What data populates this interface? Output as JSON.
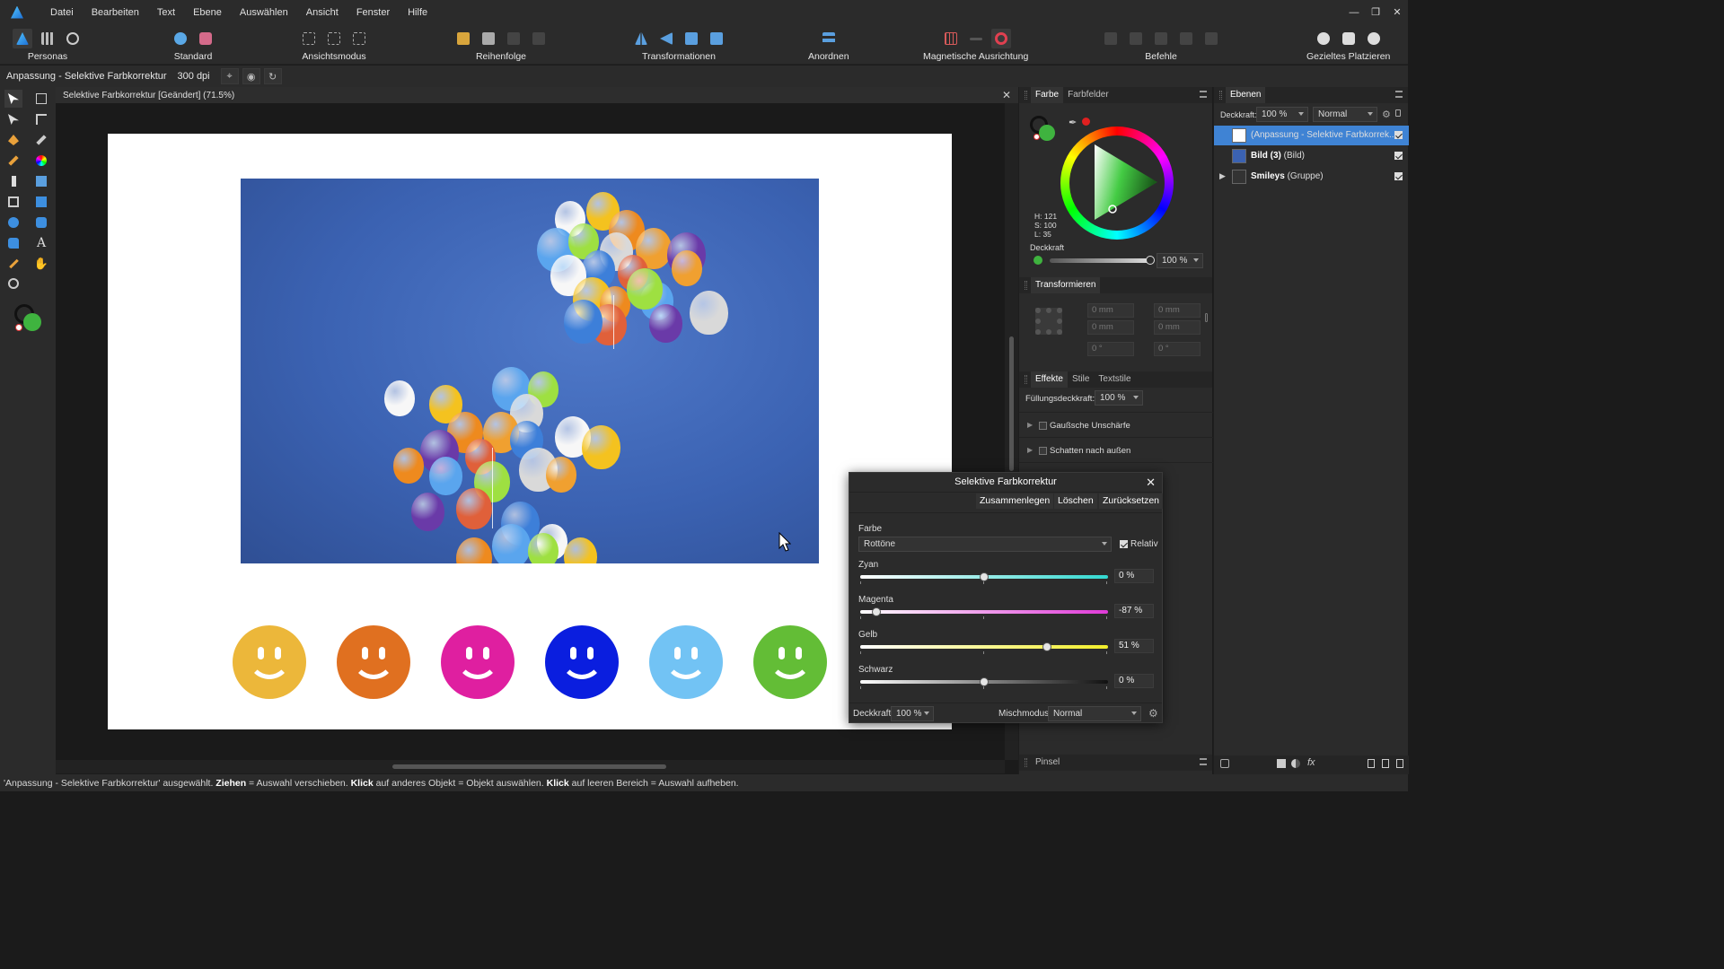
{
  "menu": {
    "items": [
      "Datei",
      "Bearbeiten",
      "Text",
      "Ebene",
      "Auswählen",
      "Ansicht",
      "Fenster",
      "Hilfe"
    ]
  },
  "toolbar": {
    "personas": "Personas",
    "standard": "Standard",
    "ansichtsmodus": "Ansichtsmodus",
    "reihenfolge": "Reihenfolge",
    "transformationen": "Transformationen",
    "anordnen": "Anordnen",
    "magnetisch": "Magnetische Ausrichtung",
    "befehle": "Befehle",
    "gezieltes": "Gezieltes Platzieren"
  },
  "context": {
    "label": "Anpassung - Selektive Farbkorrektur",
    "dpi": "300 dpi"
  },
  "document": {
    "tab_title": "Selektive Farbkorrektur [Geändert] (71.5%)"
  },
  "color_panel": {
    "tabs": [
      "Farbe",
      "Farbfelder"
    ],
    "h": "H: 121",
    "s": "S: 100",
    "l": "L: 35",
    "opacity_label": "Deckkraft",
    "opacity_value": "100 %",
    "colors": {
      "fill": "#3fb33f",
      "accent": "#e02020"
    }
  },
  "transform_panel": {
    "tab": "Transformieren",
    "x": "0 mm",
    "y": "0 mm",
    "w": "0 mm",
    "h": "0 mm",
    "r": "0 °",
    "s": "0 °"
  },
  "effects_panel": {
    "tabs": [
      "Effekte",
      "Stile",
      "Textstile"
    ],
    "fill_opacity_label": "Füllungsdeckkraft:",
    "fill_opacity_value": "100 %",
    "items": [
      "Gaußsche Unschärfe",
      "Schatten nach außen"
    ]
  },
  "brush_panel": {
    "tab": "Pinsel"
  },
  "layers_panel": {
    "tab": "Ebenen",
    "opacity_label": "Deckkraft:",
    "opacity_value": "100 %",
    "blend": "Normal",
    "layers": [
      {
        "name": "(Anpassung - Selektive Farbkorrek...",
        "bold": "",
        "selected": true
      },
      {
        "name": " (Bild)",
        "bold": "Bild (3)",
        "selected": false
      },
      {
        "name": " (Gruppe)",
        "bold": "Smileys",
        "selected": false
      }
    ]
  },
  "dialog": {
    "title": "Selektive Farbkorrektur",
    "buttons": {
      "merge": "Zusammenlegen",
      "delete": "Löschen",
      "reset": "Zurücksetzen"
    },
    "farbe_label": "Farbe",
    "farbe_value": "Rottöne",
    "relativ": "Relativ",
    "sliders": [
      {
        "label": "Zyan",
        "value": "0 %",
        "level": 0
      },
      {
        "label": "Magenta",
        "value": "-87 %",
        "level": -87
      },
      {
        "label": "Gelb",
        "value": "51 %",
        "level": 51
      },
      {
        "label": "Schwarz",
        "value": "0 %",
        "level": 0
      }
    ],
    "opacity_label": "Deckkraft:",
    "opacity_value": "100 %",
    "blend_label": "Mischmodus:",
    "blend_value": "Normal"
  },
  "smileys": {
    "colors": [
      "#ecb73a",
      "#e07020",
      "#df1fa0",
      "#0a1edf",
      "#72c3f4",
      "#63bd36"
    ]
  },
  "status": {
    "pre": "'Anpassung - Selektive Farbkorrektur' ausgewählt. ",
    "b1": "Ziehen",
    "t1": " = Auswahl verschieben. ",
    "b2": "Klick",
    "t2": " auf anderes Objekt = Objekt auswählen. ",
    "b3": "Klick",
    "t3": " auf leeren Bereich = Auswahl aufheben."
  }
}
